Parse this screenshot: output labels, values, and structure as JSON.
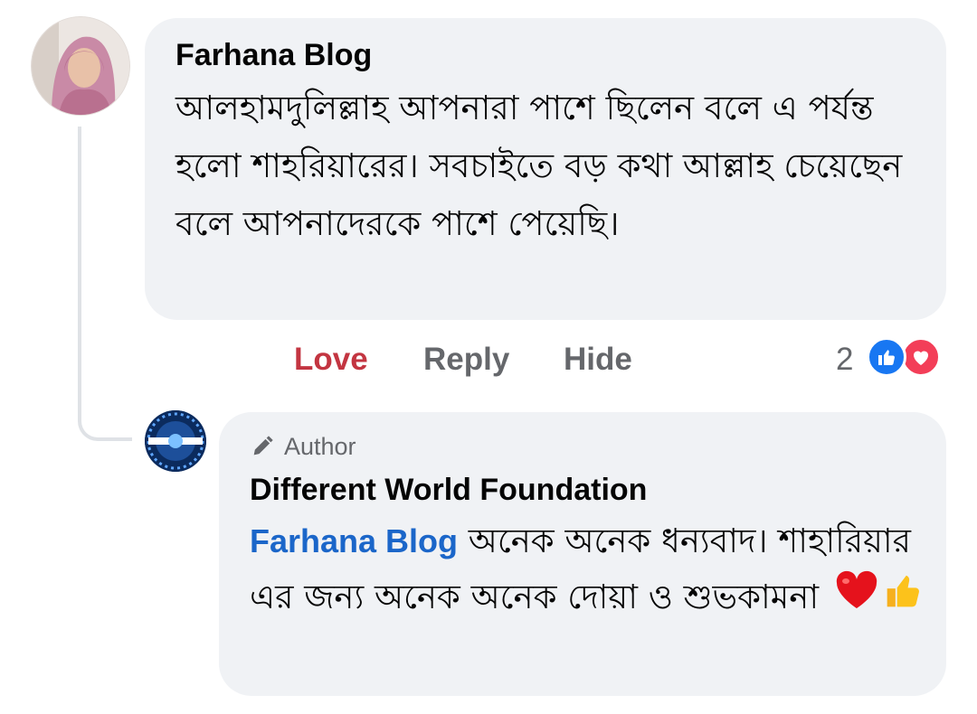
{
  "comment": {
    "author": "Farhana Blog",
    "text": "আলহামদুলিল্লাহ আপনারা পাশে ছিলেন বলে এ পর্যন্ত হলো শাহরিয়ারের। সবচাইতে বড় কথা আল্লাহ চেয়েছেন বলে আপনাদেরকে পাশে পেয়েছি।",
    "actions": {
      "love": "Love",
      "reply": "Reply",
      "hide": "Hide"
    },
    "reaction_count": "2",
    "reaction_icons": [
      "like-icon",
      "love-icon"
    ]
  },
  "reply": {
    "badge": "Author",
    "badge_icon": "pencil-icon",
    "author": "Different World Foundation",
    "mention": "Farhana Blog",
    "text": "অনেক অনেক ধন্যবাদ। শাহারিয়ার এর জন্য অনেক অনেক দোয়া ও শুভকামনা",
    "emojis": [
      "red-heart-emoji",
      "thumbs-up-emoji"
    ]
  },
  "colors": {
    "bubble": "#f0f2f5",
    "love": "#c33541",
    "muted": "#65676b",
    "link": "#1b66c9",
    "like_blue": "#1877f2",
    "love_red": "#f33e58"
  }
}
